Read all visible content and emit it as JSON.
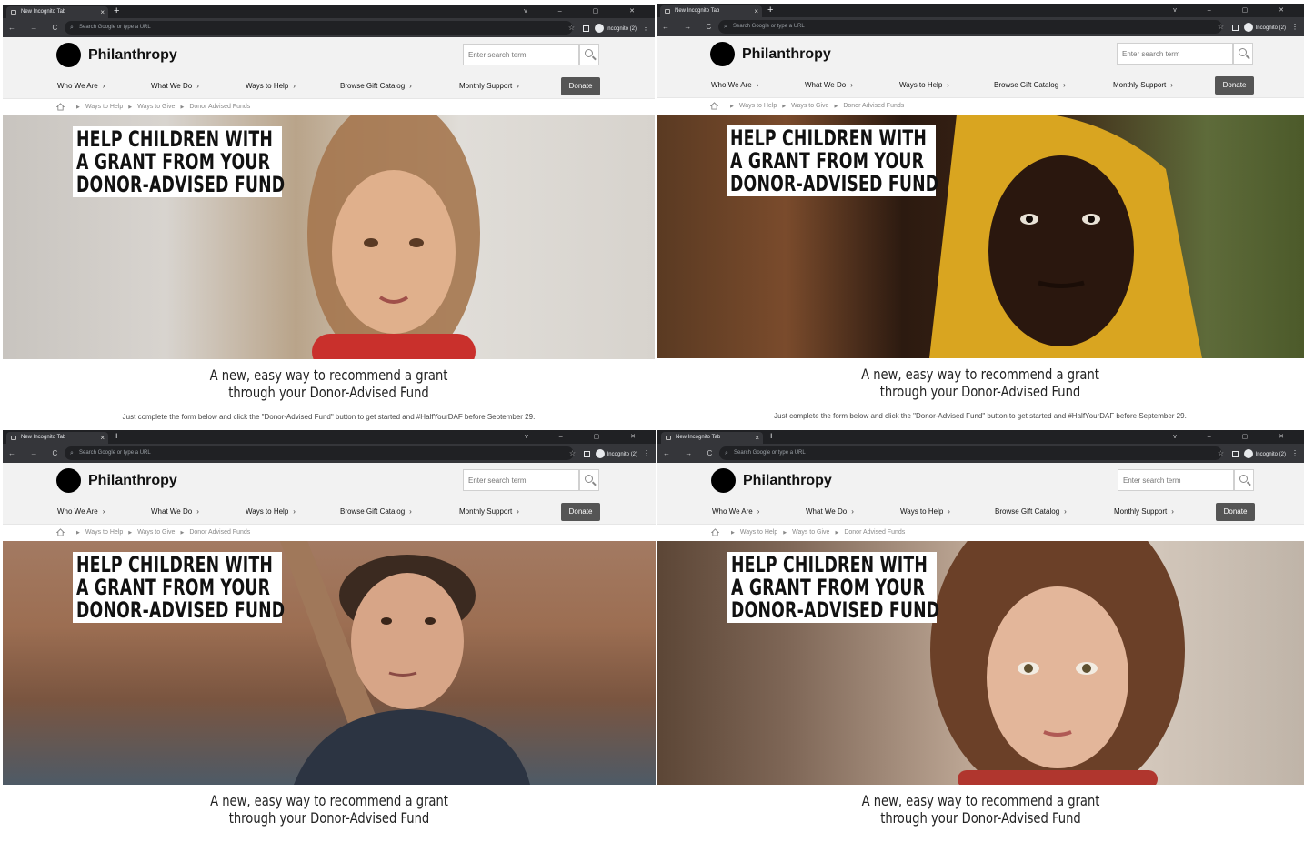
{
  "browser": {
    "tab_title": "New Incognito Tab",
    "tab_close": "×",
    "new_tab": "+",
    "window_controls": "v – ▢ ✕",
    "nav_buttons": "← → C ⌂",
    "omnibox_placeholder": "Search Google or type a URL",
    "bookmark_icon": "star-icon",
    "profile_label": "Incognito (2)",
    "menu_dots": "⋮"
  },
  "site": {
    "logo_text": "Philanthropy",
    "search_placeholder": "Enter search term",
    "nav": [
      {
        "label": "Who We Are",
        "chevron": "›"
      },
      {
        "label": "What We Do",
        "chevron": "›"
      },
      {
        "label": "Ways to Help",
        "chevron": "›"
      },
      {
        "label": "Browse Gift Catalog",
        "chevron": "›"
      },
      {
        "label": "Monthly Support",
        "chevron": "›"
      }
    ],
    "donate_label": "Donate",
    "breadcrumb": [
      "Ways to Help",
      "Ways to Give",
      "Donor Advised Funds"
    ],
    "breadcrumb_sep": "▶"
  },
  "hero": {
    "headline_lines": [
      "HELP CHILDREN WITH",
      "A GRANT FROM YOUR",
      "DONOR-ADVISED FUND"
    ],
    "subhead_lines": [
      "A new, easy way to recommend a grant",
      "through your Donor-Advised Fund"
    ],
    "intro": "Just complete the form below and click the \"Donor-Advised Fund\" button to get started and #HalfYourDAF before September 29."
  },
  "colors": {
    "chrome_dark": "#202124",
    "chrome_mid": "#35363a",
    "header_bg": "#f2f2f2",
    "donate_bg": "#555555"
  }
}
